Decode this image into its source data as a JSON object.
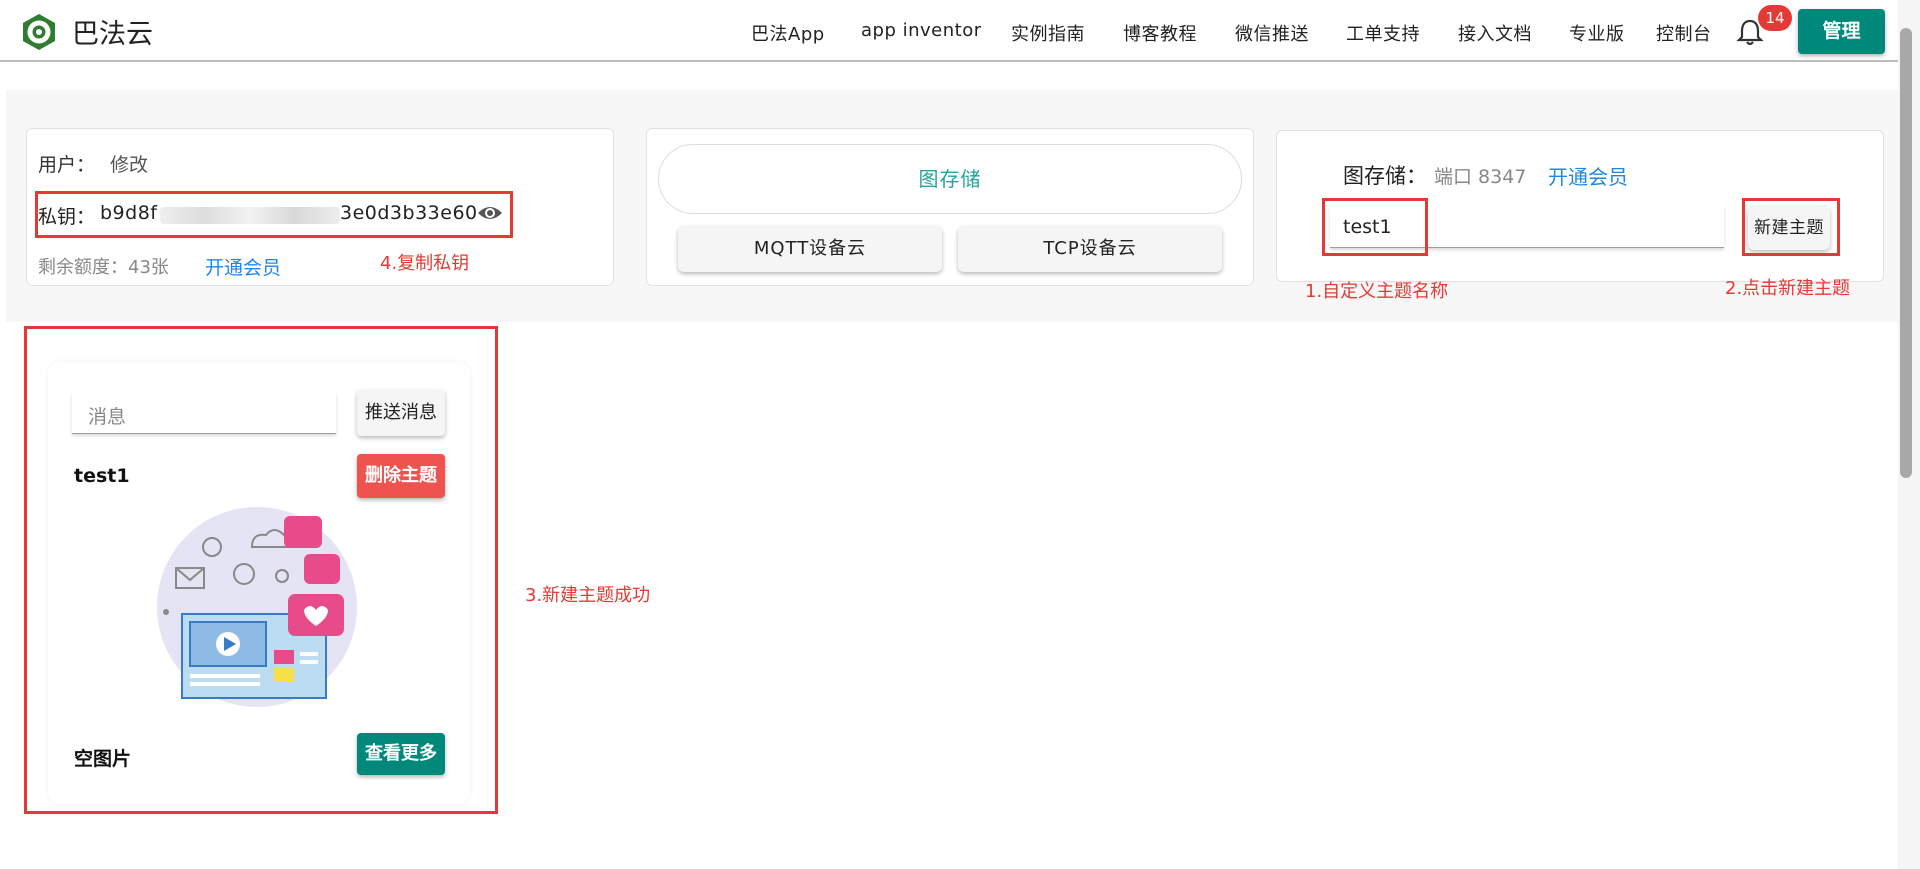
{
  "header": {
    "brand": "巴法云",
    "nav": [
      "巴法App",
      "app inventor",
      "实例指南",
      "博客教程",
      "微信推送",
      "工单支持",
      "接入文档",
      "专业版",
      "控制台"
    ],
    "notification_count": "14",
    "manage_label": "管理"
  },
  "account": {
    "user_label": "用户：",
    "edit_link": "修改",
    "key_label": "私钥：",
    "key_prefix": "b9d8f",
    "key_suffix": "3e0d3b33e60",
    "quota_label": "剩余额度：43张",
    "vip_link": "开通会员"
  },
  "cloud": {
    "active_label": "图存储",
    "mqtt_label": "MQTT设备云",
    "tcp_label": "TCP设备云"
  },
  "storage": {
    "title": "图存储：",
    "port": "端口 8347",
    "vip_link": "开通会员",
    "topic_input_value": "test1",
    "new_topic_label": "新建主题"
  },
  "annotations": {
    "step1": "1.自定义主题名称",
    "step2": "2.点击新建主题",
    "step3": "3.新建主题成功",
    "step4": "4.复制私钥"
  },
  "topic": {
    "message_placeholder": "消息",
    "push_label": "推送消息",
    "name": "test1",
    "delete_label": "删除主题",
    "image_caption": "空图片",
    "more_label": "查看更多"
  },
  "colors": {
    "teal": "#00897b",
    "link_blue": "#1e88e5",
    "annotation_red": "#e53935",
    "delete_red": "#ef5350",
    "teal_text": "#26a69a"
  }
}
